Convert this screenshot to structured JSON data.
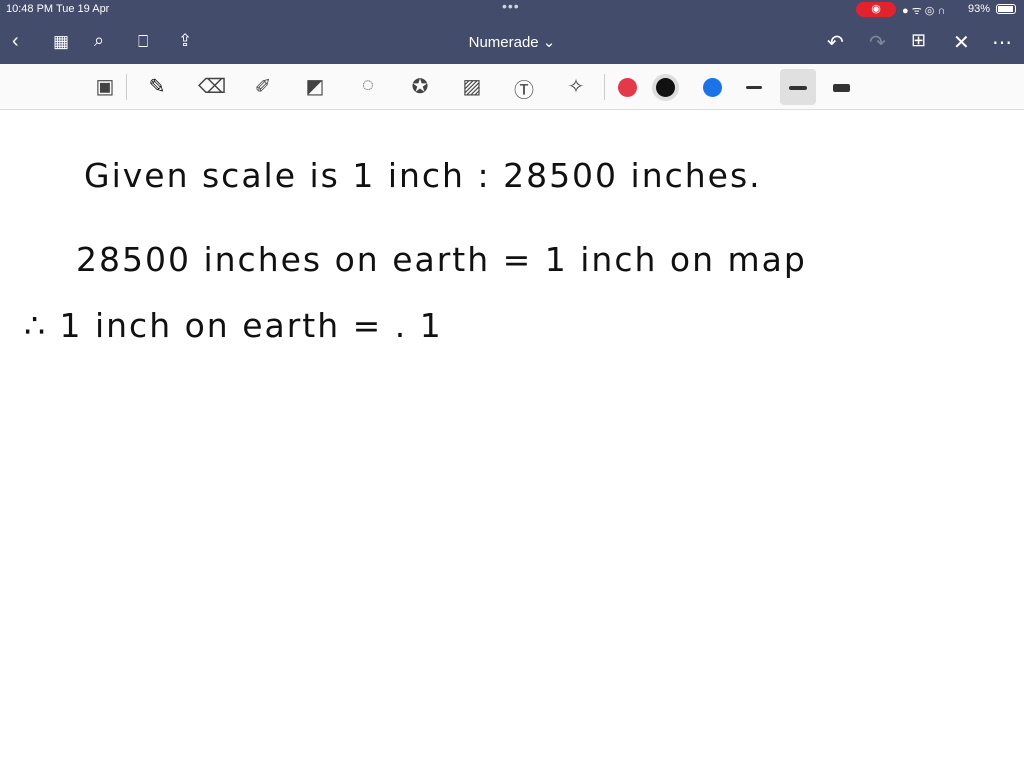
{
  "status": {
    "time": "10:48 PM  Tue 19 Apr",
    "battery": "93%",
    "battery_level": 0.93,
    "icons": "● ᯤ ◎ ∩"
  },
  "app": {
    "title": "Numerade ⌄"
  },
  "colors": {
    "bar": "#434c6b",
    "red": "#e5394a",
    "black": "#111111",
    "blue": "#1a74e8"
  },
  "note": {
    "lines": [
      "Given   scale  is    1 inch : 28500  inches.",
      "28500  inches  on  earth   =   1  inch   on  map",
      "∴    1  inch  on  earth   =  .  1"
    ]
  }
}
